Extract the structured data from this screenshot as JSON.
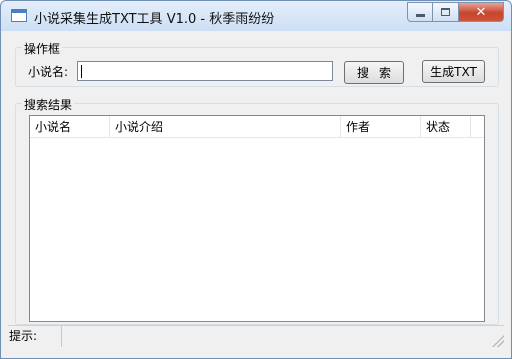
{
  "window": {
    "title": "小说采集生成TXT工具 V1.0 - 秋季雨纷纷",
    "minimize_icon": "minimize-icon",
    "maximize_icon": "maximize-icon",
    "close_glyph": "✕"
  },
  "operation": {
    "legend": "操作框",
    "novel_label": "小说名:",
    "novel_value": "",
    "search_label": "搜索",
    "generate_label": "生成TXT"
  },
  "results": {
    "legend": "搜索结果",
    "columns": [
      "小说名",
      "小说介绍",
      "作者",
      "状态"
    ],
    "rows": []
  },
  "status": {
    "label": "提示:",
    "text": ""
  }
}
